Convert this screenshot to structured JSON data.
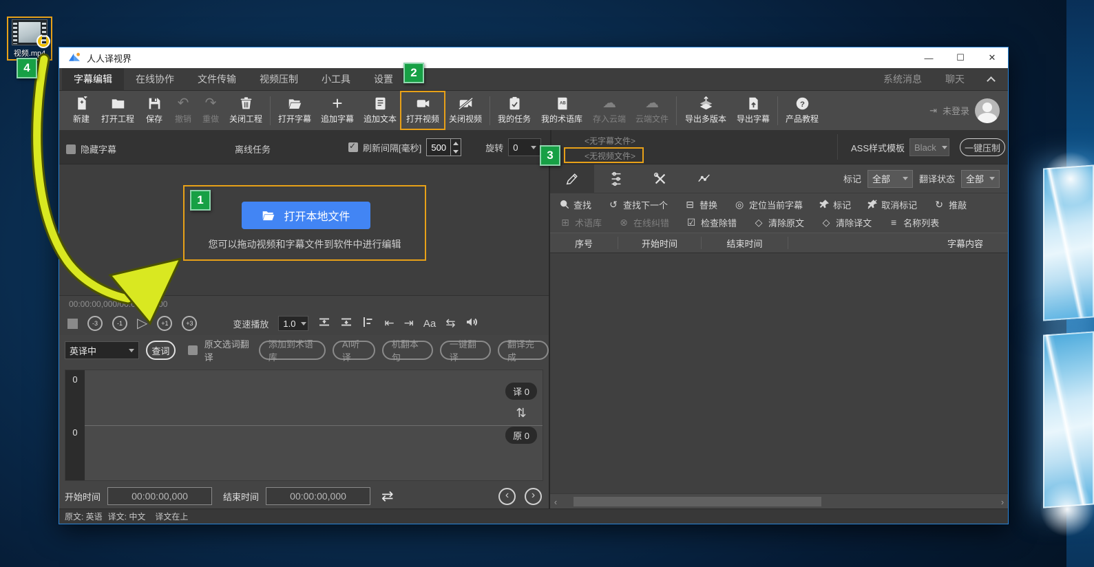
{
  "colors": {
    "highlight_orange": "#e8a118",
    "badge_green": "#17a045",
    "button_blue": "#4285f4",
    "arrow_yellow": "#d9e821"
  },
  "desktop": {
    "file_label": "视频.mp4"
  },
  "badges": {
    "one": "1",
    "two": "2",
    "three": "3",
    "four": "4"
  },
  "titlebar": {
    "title": "人人译视界"
  },
  "menu": {
    "items": [
      "字幕编辑",
      "在线协作",
      "文件传输",
      "视频压制",
      "小工具",
      "设置"
    ],
    "right": [
      "系统消息",
      "聊天"
    ]
  },
  "toolbar": {
    "buttons": [
      "新建",
      "打开工程",
      "保存",
      "撤销",
      "重做",
      "关闭工程",
      "打开字幕",
      "追加字幕",
      "追加文本",
      "打开视频",
      "关闭视频",
      "我的任务",
      "我的术语库",
      "存入云端",
      "云端文件",
      "导出多版本",
      "导出字幕",
      "产品教程"
    ],
    "login": "未登录"
  },
  "options": {
    "hide_subtitle": "隐藏字幕",
    "offline_task": "离线任务",
    "refresh_label": "刷新间隔[毫秒]",
    "refresh_value": "500",
    "rotate_label": "旋转",
    "rotate_value": "0",
    "no_subtitle_file": "<无字幕文件>",
    "no_video_file": "<无视频文件>",
    "ass_label": "ASS样式模板",
    "ass_value": "Black",
    "compress": "一键压制"
  },
  "video_panel": {
    "open_button": "打开本地文件",
    "hint": "您可以拖动视频和字幕文件到软件中进行编辑"
  },
  "playback": {
    "time": "00:00:00,000/00:00:00,000",
    "skip": [
      "-3",
      "-1",
      "+1",
      "+3"
    ],
    "play": "▷",
    "speed_label": "变速播放",
    "speed_value": "1.0",
    "font_icon": "Aa"
  },
  "translate": {
    "lang": "英译中",
    "lookup": "查词",
    "select_word": "原文选词翻译",
    "add_glossary": "添加到术语库",
    "ai_listen": "AI听译",
    "mt_sentence": "机翻本句",
    "one_key": "一键翻译",
    "done": "翻译完成"
  },
  "editor": {
    "line1": "0",
    "line2": "0",
    "trans_count": "译 0",
    "source_count": "原 0"
  },
  "times": {
    "start_label": "开始时间",
    "start_value": "00:00:00,000",
    "end_label": "结束时间",
    "end_value": "00:00:00,000"
  },
  "status_bar": {
    "source": "原文: 英语",
    "target": "译文: 中文",
    "position": "译文在上"
  },
  "right_panel": {
    "mark_label": "标记",
    "mark_value": "全部",
    "trans_status_label": "翻译状态",
    "trans_status_value": "全部",
    "tools_row1": [
      "查找",
      "查找下一个",
      "替换",
      "定位当前字幕",
      "标记",
      "取消标记",
      "推敲"
    ],
    "tools_row2": [
      "术语库",
      "在线纠错",
      "检查除错",
      "清除原文",
      "清除译文",
      "名称列表"
    ],
    "table_headers": [
      "序号",
      "开始时间",
      "结束时间",
      "字幕内容"
    ]
  },
  "icons": {
    "undo": "↶",
    "redo": "↷",
    "plus": "+",
    "cloud_save": "☁",
    "cloud_file": "☁",
    "question": "?",
    "glossary_ab": "AB",
    "play_badge": "▶",
    "search_next": "↺",
    "replace": "⊟",
    "locate": "◎",
    "refine": "↻",
    "glossary": "⊞",
    "online_correct": "⊗",
    "check_error": "☑",
    "clear": "◇",
    "name_list": "≡",
    "to_start": "⇤",
    "to_end": "⇥",
    "swap": "⇆",
    "updown": "⇅",
    "loop": "⇄",
    "prev": "‹",
    "next": "›",
    "login_arrow": "⇥"
  }
}
